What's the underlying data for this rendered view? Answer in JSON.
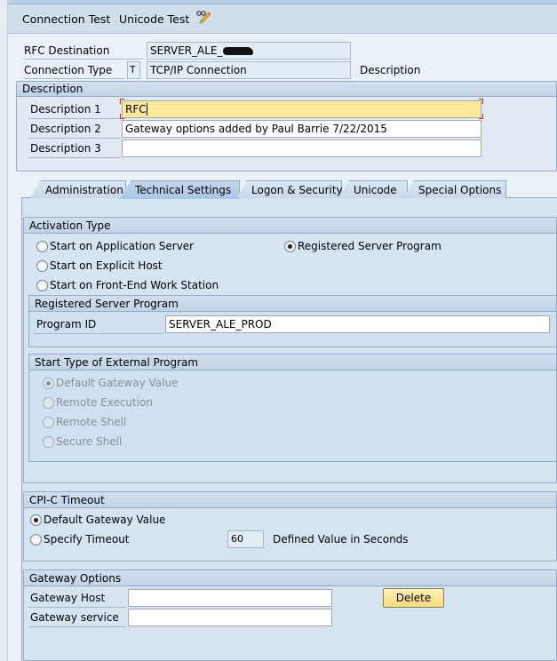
{
  "toolbar": {
    "connection_test": "Connection Test",
    "unicode_test": "Unicode Test",
    "edit_icon": "glasses-pencil-icon"
  },
  "header": {
    "rfc_destination_label": "RFC Destination",
    "rfc_destination_value": "SERVER_ALE_",
    "connection_type_label": "Connection Type",
    "connection_type_code": "T",
    "connection_type_value": "TCP/IP Connection",
    "description_label": "Description"
  },
  "description_group": {
    "title": "Description",
    "fields": [
      {
        "label": "Description 1",
        "value": "RFC"
      },
      {
        "label": "Description 2",
        "value": "Gateway options added by Paul Barrie 7/22/2015"
      },
      {
        "label": "Description 3",
        "value": ""
      }
    ]
  },
  "tabs": [
    {
      "label": "Administration",
      "active": false
    },
    {
      "label": "Technical Settings",
      "active": true
    },
    {
      "label": "Logon & Security",
      "active": false
    },
    {
      "label": "Unicode",
      "active": false
    },
    {
      "label": "Special Options",
      "active": false
    }
  ],
  "activation_type": {
    "title": "Activation Type",
    "options": [
      {
        "label": "Start on Application Server",
        "selected": false
      },
      {
        "label": "Registered Server Program",
        "selected": true
      },
      {
        "label": "Start on Explicit Host",
        "selected": false
      },
      {
        "label": "Start on Front-End Work Station",
        "selected": false
      }
    ]
  },
  "registered_server_program": {
    "title": "Registered Server Program",
    "program_id_label": "Program ID",
    "program_id_value": "SERVER_ALE_PROD"
  },
  "start_type": {
    "title": "Start Type of External Program",
    "options": [
      {
        "label": "Default Gateway Value",
        "selected": true
      },
      {
        "label": "Remote Execution",
        "selected": false
      },
      {
        "label": "Remote Shell",
        "selected": false
      },
      {
        "label": "Secure Shell",
        "selected": false
      }
    ]
  },
  "cpic_timeout": {
    "title": "CPI-C Timeout",
    "options": [
      {
        "label": "Default Gateway Value",
        "selected": true
      },
      {
        "label": "Specify Timeout",
        "selected": false
      }
    ],
    "timeout_value": "60",
    "timeout_unit_label": "Defined Value in Seconds"
  },
  "gateway_options": {
    "title": "Gateway Options",
    "host_label": "Gateway Host",
    "host_value": "",
    "service_label": "Gateway service",
    "service_value": "",
    "delete_label": "Delete"
  }
}
